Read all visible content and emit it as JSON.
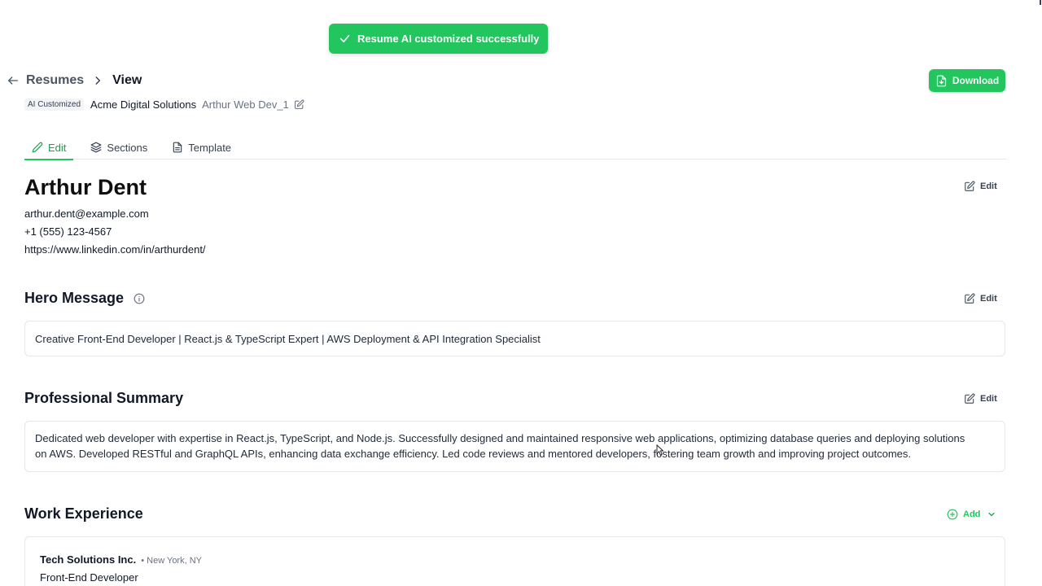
{
  "toast": {
    "message": "Resume AI customized successfully",
    "icon": "check-icon"
  },
  "header": {
    "breadcrumb_root": "Resumes",
    "breadcrumb_current": "View",
    "badge": "AI Customized",
    "company": "Acme Digital Solutions",
    "resume_name": "Arthur Web Dev_1",
    "download_label": "Download"
  },
  "tabs": [
    {
      "label": "Edit",
      "icon": "pencil-icon",
      "active": true
    },
    {
      "label": "Sections",
      "icon": "layers-icon",
      "active": false
    },
    {
      "label": "Template",
      "icon": "document-icon",
      "active": false
    }
  ],
  "profile": {
    "name": "Arthur Dent",
    "email": "arthur.dent@example.com",
    "phone": "+1 (555) 123-4567",
    "linkedin": "https://www.linkedin.com/in/arthurdent/",
    "edit_label": "Edit"
  },
  "hero": {
    "title": "Hero Message",
    "text": "Creative Front-End Developer | React.js & TypeScript Expert | AWS Deployment & API Integration Specialist",
    "edit_label": "Edit"
  },
  "summary": {
    "title": "Professional Summary",
    "line1": "Dedicated web developer with expertise in React.js, TypeScript, and Node.js. Successfully designed and maintained responsive web applications, optimizing database queries and deploying solutions",
    "line2": "on AWS. Developed RESTful and GraphQL APIs, enhancing data exchange efficiency. Led code reviews and mentored developers, fostering team growth and improving project outcomes.",
    "edit_label": "Edit"
  },
  "work": {
    "title": "Work Experience",
    "add_label": "Add",
    "jobs": [
      {
        "company": "Tech Solutions Inc.",
        "location": "• New York, NY",
        "title": "Front-End Developer"
      }
    ]
  },
  "colors": {
    "accent": "#22c55e",
    "accent_dark": "#16a34a",
    "border": "#e5e7eb"
  }
}
